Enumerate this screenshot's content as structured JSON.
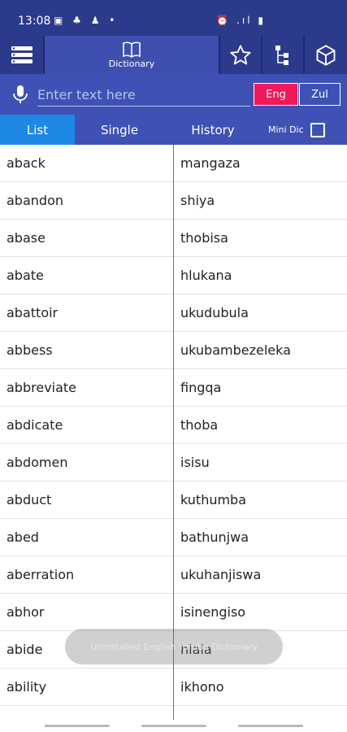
{
  "status_bar": {
    "time": "13:08",
    "left_icons": "▣ ♣ ♟ •",
    "right_icons": "⏰ .ıl ▮"
  },
  "toolbar": {
    "dictionary_label": "Dictionary"
  },
  "search": {
    "placeholder": "Enter text here",
    "value": ""
  },
  "languages": {
    "source": "Eng",
    "target": "Zul",
    "active": "Eng",
    "active_color": "#f0195a"
  },
  "tabs": [
    {
      "label": "List",
      "active": true
    },
    {
      "label": "Single",
      "active": false
    },
    {
      "label": "History",
      "active": false
    }
  ],
  "mini_dic": {
    "label": "Mini Dic",
    "checked": false
  },
  "entries": [
    {
      "en": "aback",
      "zu": "mangaza"
    },
    {
      "en": "abandon",
      "zu": "shiya"
    },
    {
      "en": "abase",
      "zu": "thobisa"
    },
    {
      "en": "abate",
      "zu": "hlukana"
    },
    {
      "en": "abattoir",
      "zu": "ukudubula"
    },
    {
      "en": "abbess",
      "zu": "ukubambezeleka"
    },
    {
      "en": "abbreviate",
      "zu": "fingqa"
    },
    {
      "en": "abdicate",
      "zu": "thoba"
    },
    {
      "en": "abdomen",
      "zu": "isisu"
    },
    {
      "en": "abduct",
      "zu": "kuthumba"
    },
    {
      "en": "abed",
      "zu": "bathunjwa"
    },
    {
      "en": "aberration",
      "zu": "ukuhanjiswa"
    },
    {
      "en": "abhor",
      "zu": "isinengiso"
    },
    {
      "en": "abide",
      "zu": "hlala"
    },
    {
      "en": "ability",
      "zu": "ikhono"
    }
  ],
  "toast": "Uninstalled English Yoruba Dictionary",
  "colors": {
    "header": "#2c3a8c",
    "bar": "#3f51b5",
    "active_tab": "#1e88e5",
    "divider": "#2e8b7a"
  }
}
